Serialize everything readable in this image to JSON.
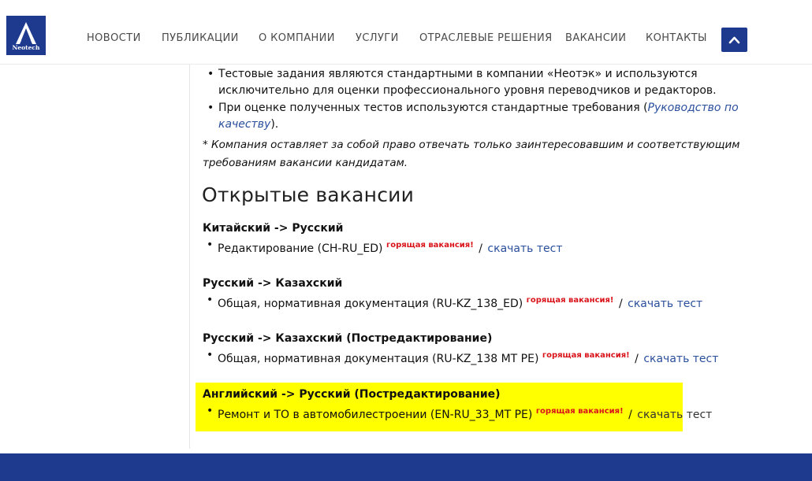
{
  "brand": {
    "logo_text": "Neotech"
  },
  "nav": {
    "items": [
      "НОВОСТИ",
      "ПУБЛИКАЦИИ",
      "О КОМПАНИИ",
      "УСЛУГИ",
      "ОТРАСЛЕВЫЕ РЕШЕНИЯ",
      "ВАКАНСИИ",
      "КОНТАКТЫ"
    ]
  },
  "rules": {
    "item1": "Тестовые задания являются стандартными в компании «Неотэк» и используются исключительно для оценки профессионального уровня переводчиков и редакторов.",
    "item2_prefix": "При оценке полученных тестов используются стандартные требования (",
    "item2_link": "Руководство по качеству",
    "item2_suffix": ")."
  },
  "note": "* Компания оставляет за собой право отвечать только заинтересовавшим и соответствующим требованиям вакансии кандидатам.",
  "vacancies_heading": "Открытые вакансии",
  "hot_label": "горящая вакансия!",
  "separator": "/",
  "download_label": "скачать тест",
  "vacancies": [
    {
      "title": "Китайский -> Русский",
      "item": "Редактирование (CH-RU_ED)"
    },
    {
      "title": "Русский -> Казахский",
      "item": "Общая, нормативная документация (RU-KZ_138_ED)"
    },
    {
      "title": "Русский -> Казахский (Постредактирование)",
      "item": "Общая, нормативная документация (RU-KZ_138 MT PE)"
    },
    {
      "title": "Английский -> Русский (Постредактирование)",
      "item": "Ремонт и ТО в автомобилестроении (EN-RU_33_MT PE)",
      "highlighted": true
    }
  ],
  "colors": {
    "brand_blue": "#1e3a8f",
    "link": "#2a4f9c",
    "hot": "#d9141b",
    "highlight": "#ffff00"
  }
}
